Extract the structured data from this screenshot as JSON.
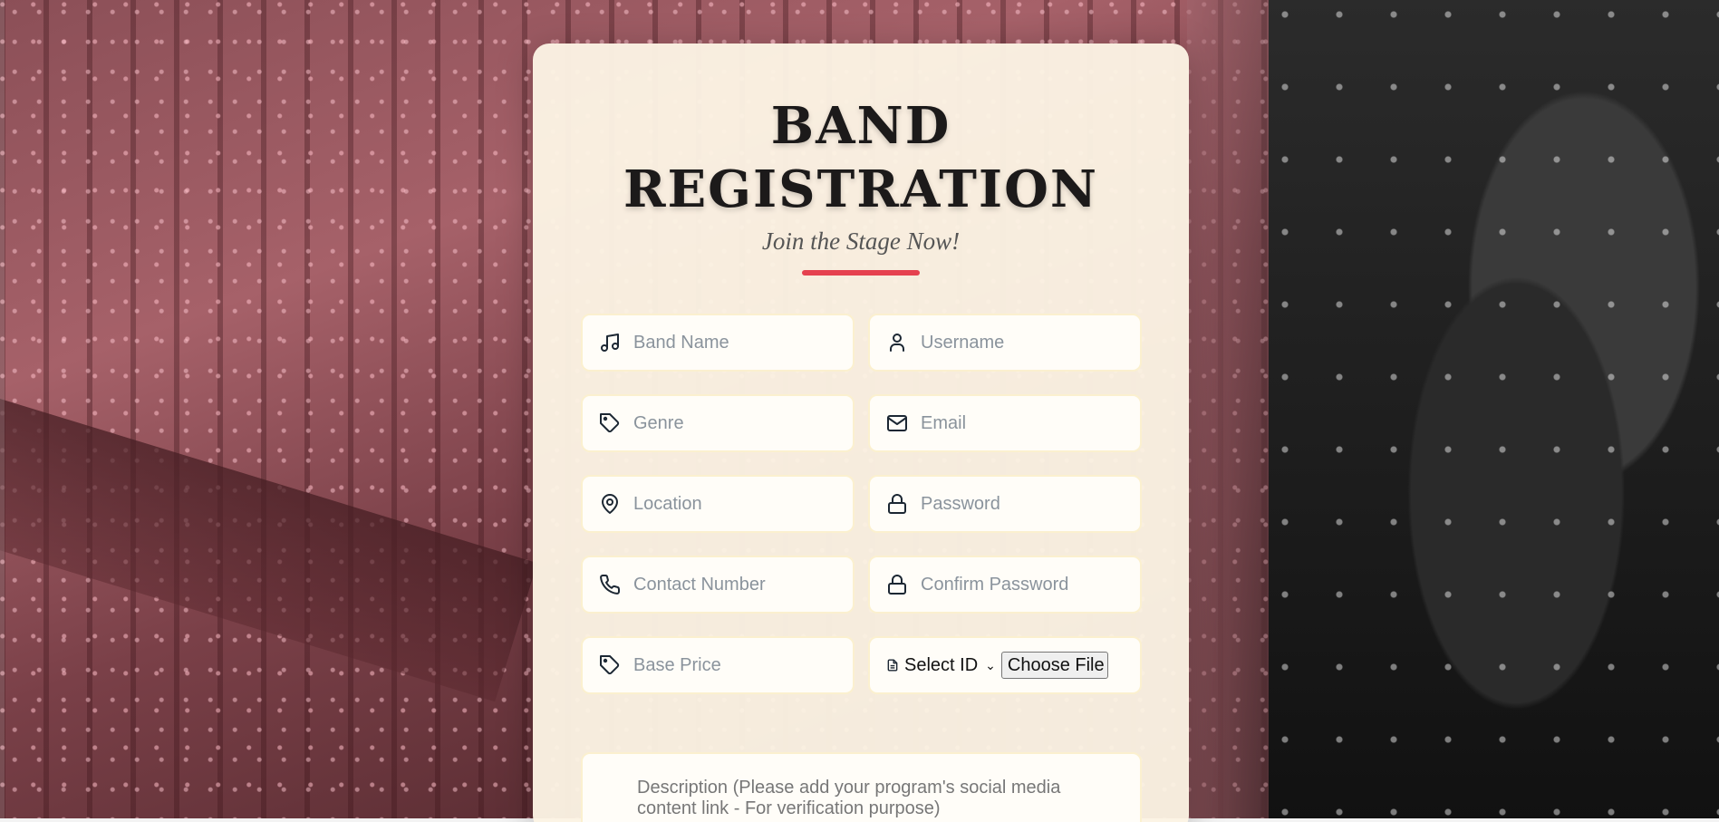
{
  "form": {
    "title_line1": "BAND",
    "title_line2": "REGISTRATION",
    "subtitle": "Join the Stage Now!",
    "accent_color": "#e5414f",
    "fields": {
      "band_name": {
        "placeholder": "Band Name",
        "icon": "music-note-icon"
      },
      "username": {
        "placeholder": "Username",
        "icon": "user-icon"
      },
      "genre": {
        "placeholder": "Genre",
        "icon": "tag-icon"
      },
      "email": {
        "placeholder": "Email",
        "icon": "mail-icon"
      },
      "location": {
        "placeholder": "Location",
        "icon": "map-pin-icon"
      },
      "password": {
        "placeholder": "Password",
        "icon": "lock-icon"
      },
      "contact_number": {
        "placeholder": "Contact Number",
        "icon": "phone-icon"
      },
      "confirm_password": {
        "placeholder": "Confirm Password",
        "icon": "lock-icon"
      },
      "base_price": {
        "placeholder": "Base Price",
        "icon": "tag-icon"
      }
    },
    "id_upload": {
      "icon": "document-icon",
      "select_value": "Select ID",
      "file_button": "Choose File"
    },
    "description_placeholder": "Description (Please add your program's social media content link - For verification purpose)"
  }
}
